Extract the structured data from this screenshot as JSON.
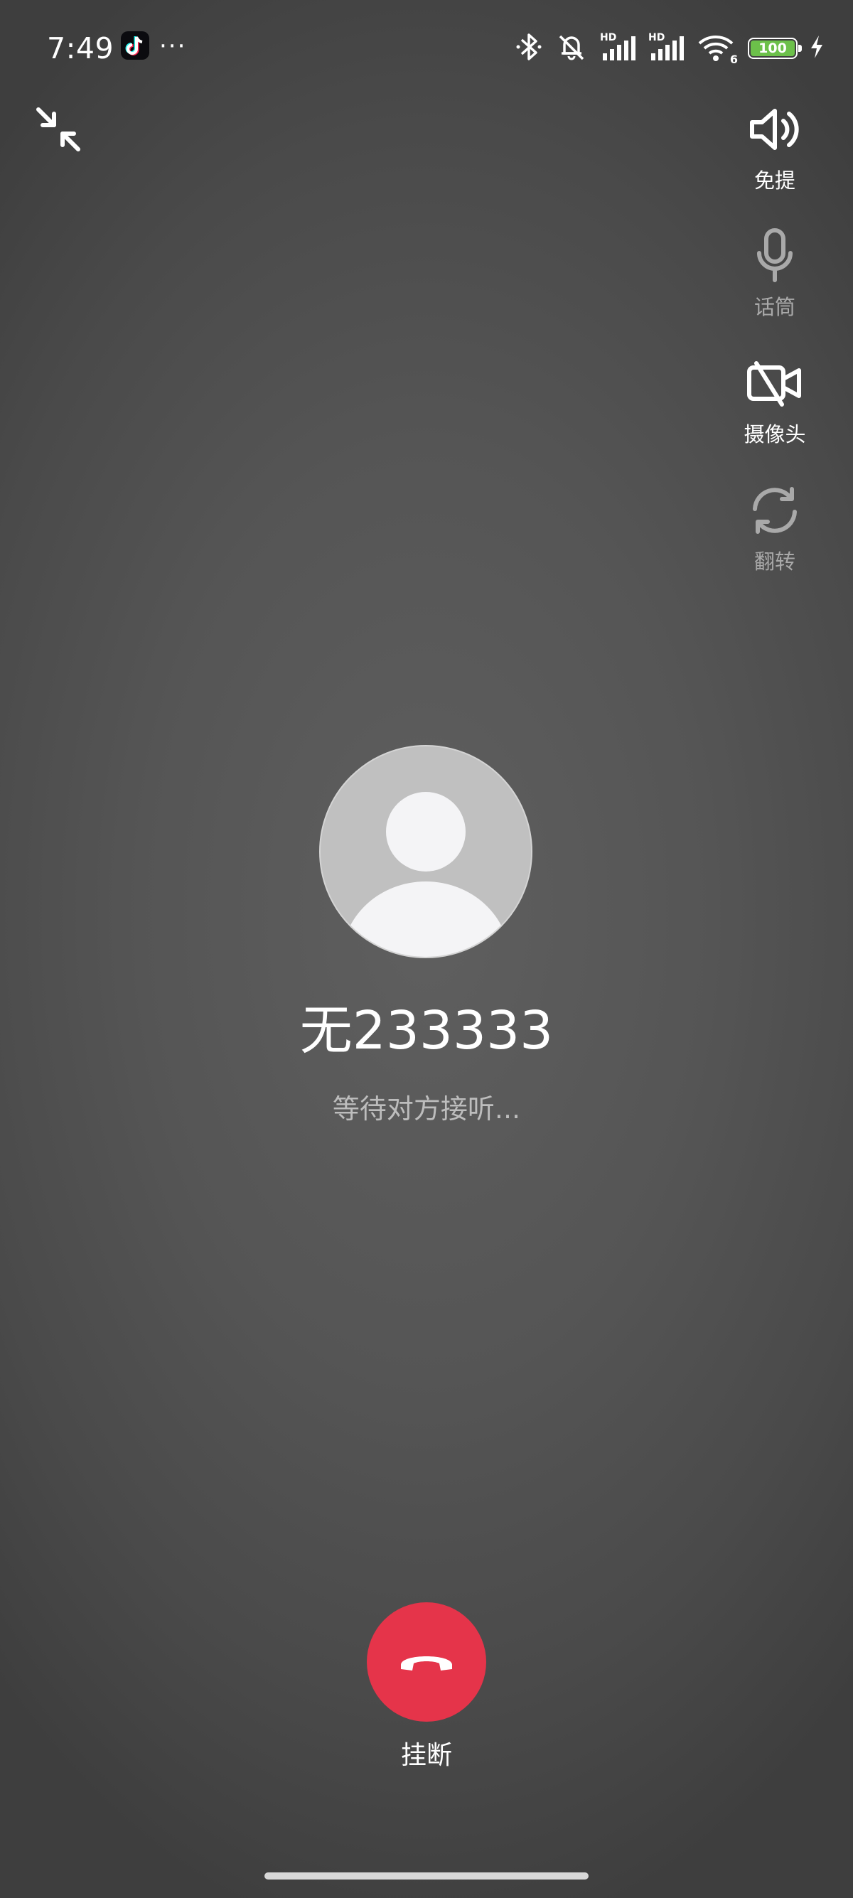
{
  "status_bar": {
    "time": "7:49",
    "more": "···",
    "hd_1": "HD",
    "hd_2": "HD",
    "wifi_badge": "6",
    "battery_level": "100",
    "battery_color": "#6cc04a"
  },
  "controls": {
    "speaker": "免提",
    "microphone": "话筒",
    "camera": "摄像头",
    "flip": "翻转"
  },
  "caller": {
    "name": "无233333",
    "status": "等待对方接听..."
  },
  "hangup": {
    "label": "挂断",
    "color": "#e5344a"
  }
}
